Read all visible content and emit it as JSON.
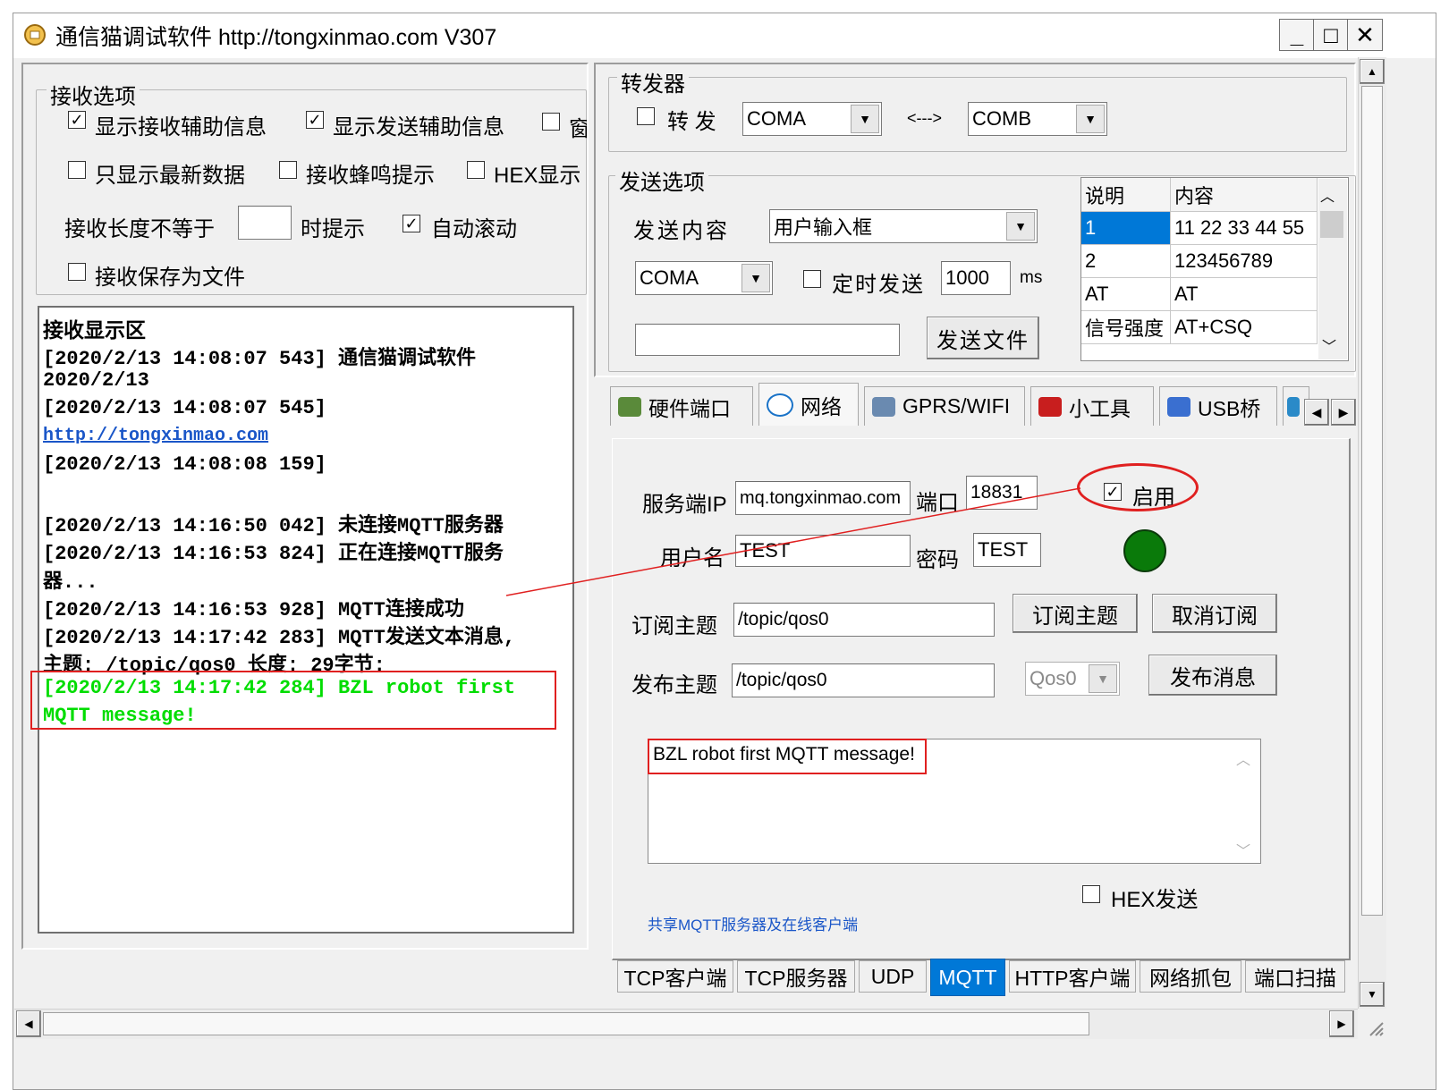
{
  "window": {
    "title": "通信猫调试软件  http://tongxinmao.com  V307",
    "minimize": "_",
    "maximize": "□",
    "close": "✕"
  },
  "recv_options": {
    "legend": "接收选项",
    "show_recv_info": "显示接收辅助信息",
    "show_send_info": "显示发送辅助信息",
    "truncated_option": "窗",
    "only_latest": "只显示最新数据",
    "recv_beep": "接收蜂鸣提示",
    "hex_display": "HEX显示",
    "len_label": "接收长度不等于",
    "len_value": "",
    "len_suffix": "时提示",
    "auto_scroll": "自动滚动",
    "save_to_file": "接收保存为文件"
  },
  "recv_display": {
    "title": "接收显示区",
    "lines": [
      "[2020/2/13 14:08:07 543]  通信猫调试软件",
      "2020/2/13",
      "[2020/2/13 14:08:07 545]",
      "http://tongxinmao.com",
      "[2020/2/13 14:08:08 159]",
      "",
      "[2020/2/13 14:16:50 042]  未连接MQTT服务器",
      "[2020/2/13 14:16:53 824]  正在连接MQTT服务",
      "器...",
      "[2020/2/13 14:16:53 928]  MQTT连接成功",
      "[2020/2/13 14:17:42 283]  MQTT发送文本消息,",
      "主题: /topic/qos0 长度: 29字节:",
      "[2020/2/13 14:17:42 284]  BZL robot first",
      "MQTT message!"
    ]
  },
  "forwarder": {
    "legend": "转发器",
    "forward_label": "转 发",
    "port_a": "COMA",
    "arrow": "<--->",
    "port_b": "COMB"
  },
  "send_options": {
    "legend": "发送选项",
    "content_label": "发送内容",
    "content_value": "用户输入框",
    "port_value": "COMA",
    "timed_send": "定时发送",
    "interval": "1000",
    "interval_unit": "ms",
    "file_path": "",
    "send_file_button": "发送文件",
    "table": {
      "headers": [
        "说明",
        "内容"
      ],
      "rows": [
        [
          "1",
          "11 22 33 44 55"
        ],
        [
          "2",
          "123456789"
        ],
        [
          "AT",
          "AT"
        ],
        [
          "信号强度",
          "AT+CSQ"
        ]
      ]
    }
  },
  "top_tabs": [
    "硬件端口",
    "网络",
    "GPRS/WIFI",
    "小工具",
    "USB桥"
  ],
  "mqtt": {
    "server_ip_label": "服务端IP",
    "server_ip": "mq.tongxinmao.com",
    "port_label": "端口",
    "port": "18831",
    "enable_label": "启用",
    "username_label": "用户名",
    "username": "TEST",
    "password_label": "密码",
    "password": "TEST",
    "status_color": "#0a7a0a",
    "subscribe_label": "订阅主题",
    "subscribe_topic": "/topic/qos0",
    "subscribe_button": "订阅主题",
    "unsubscribe_button": "取消订阅",
    "publish_label": "发布主题",
    "publish_topic": "/topic/qos0",
    "qos_value": "Qos0",
    "publish_button": "发布消息",
    "message": "BZL robot first MQTT message!",
    "hex_send": "HEX发送",
    "shared_link": "共享MQTT服务器及在线客户端"
  },
  "bottom_tabs": [
    "TCP客户端",
    "TCP服务器",
    "UDP",
    "MQTT",
    "HTTP客户端",
    "网络抓包",
    "端口扫描"
  ],
  "colors": {
    "accent": "#0078d7",
    "highlight_green": "#00dd00",
    "annotation_red": "#e02020",
    "link_blue": "#1a56c8"
  }
}
